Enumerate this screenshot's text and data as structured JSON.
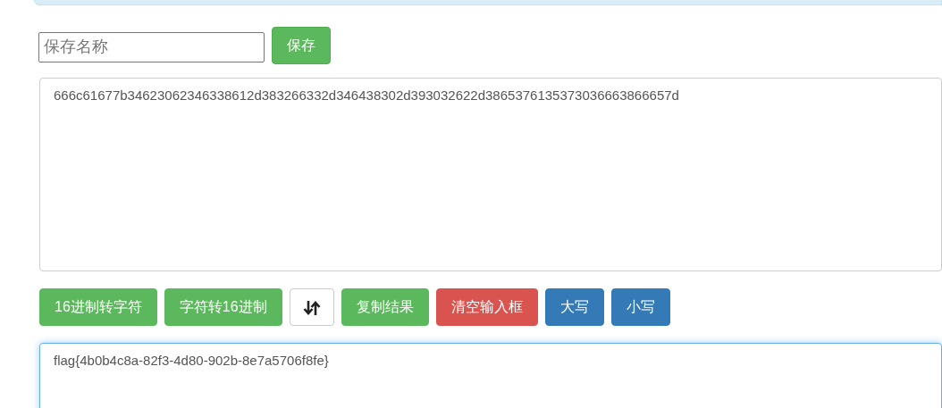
{
  "save_form": {
    "name_field": {
      "placeholder": "保存名称"
    },
    "save_button": "保存"
  },
  "input_text": "666c61677b34623062346338612d383266332d346438302d393032622d3865376135373036663866657d",
  "actions": [
    {
      "kind": "text",
      "label": "16进制转字符",
      "color": "#5cb85c"
    },
    {
      "kind": "text",
      "label": "字符转16进制",
      "color": "#5cb85c"
    },
    {
      "kind": "swap",
      "color": "#ffffff"
    },
    {
      "kind": "text",
      "label": "复制结果",
      "color": "#5cb85c"
    },
    {
      "kind": "text",
      "label": "清空输入框",
      "color": "#d9534f"
    },
    {
      "kind": "text",
      "label": "大写",
      "color": "#337ab7"
    },
    {
      "kind": "text",
      "label": "小写",
      "color": "#337ab7"
    }
  ],
  "output_text": "flag{4b0b4c8a-82f3-4d80-902b-8e7a5706f8fe}"
}
